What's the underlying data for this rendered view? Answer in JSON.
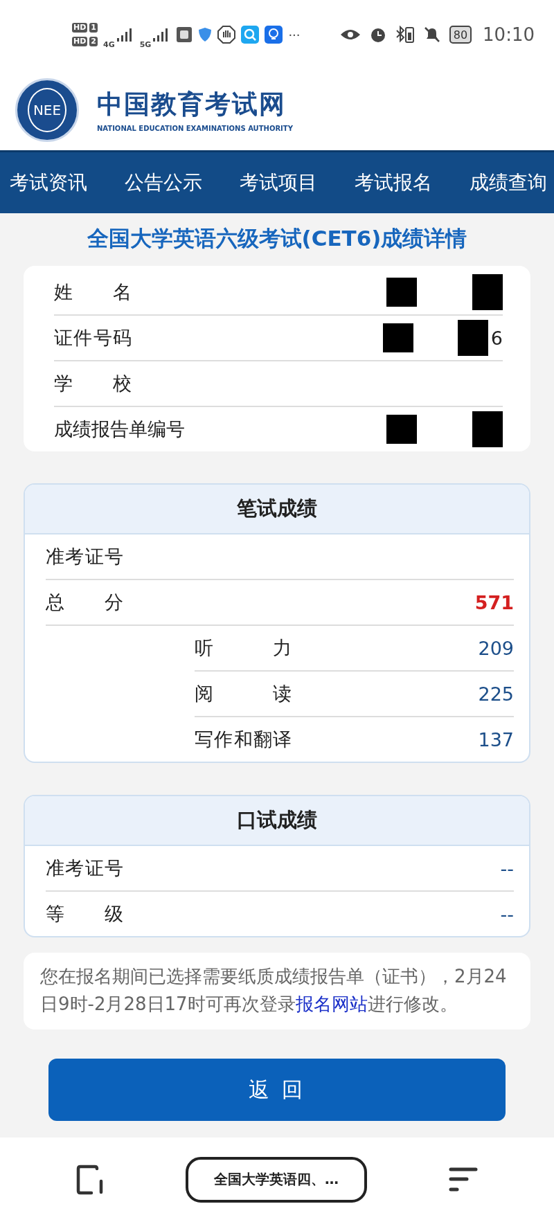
{
  "status_bar": {
    "sim_labels": [
      {
        "text": "HD",
        "slot": "1"
      },
      {
        "text": "HD",
        "slot": "2"
      }
    ],
    "networks": [
      "4G",
      "5G"
    ],
    "more": "···",
    "battery": "80",
    "time": "10:10"
  },
  "site": {
    "title": "中国教育考试网",
    "subtitle": "NATIONAL EDUCATION EXAMINATIONS AUTHORITY",
    "emblem": "NEE"
  },
  "nav": [
    "考试资讯",
    "公告公示",
    "考试项目",
    "考试报名",
    "成绩查询"
  ],
  "page_title": "全国大学英语六级考试(CET6)成绩详情",
  "personal_info": [
    {
      "label": "姓名",
      "redacted": true
    },
    {
      "label": "证件号码",
      "value": "6",
      "redacted": true
    },
    {
      "label": "学校",
      "redacted": false
    },
    {
      "label": "成绩报告单编号",
      "redacted": true
    }
  ],
  "written": {
    "title": "笔试成绩",
    "rows": [
      {
        "label": "准考证号"
      },
      {
        "label": "总分",
        "value": "571",
        "kind": "total"
      }
    ],
    "parts": [
      {
        "label": "听力",
        "value": "209"
      },
      {
        "label": "阅读",
        "value": "225"
      },
      {
        "label": "写作和翻译",
        "value": "137"
      }
    ]
  },
  "oral": {
    "title": "口试成绩",
    "rows": [
      {
        "label": "准考证号",
        "value": "--"
      },
      {
        "label": "等级",
        "value": "--"
      }
    ]
  },
  "notice": {
    "text": "您在报名期间已选择需要纸质成绩报告单（证书），2月24日9时-2月28日17时可再次登录",
    "link": "报名网站",
    "after": "进行修改。"
  },
  "back_button": "返 回",
  "browser_bar": {
    "tab_title": "全国大学英语四、…"
  }
}
